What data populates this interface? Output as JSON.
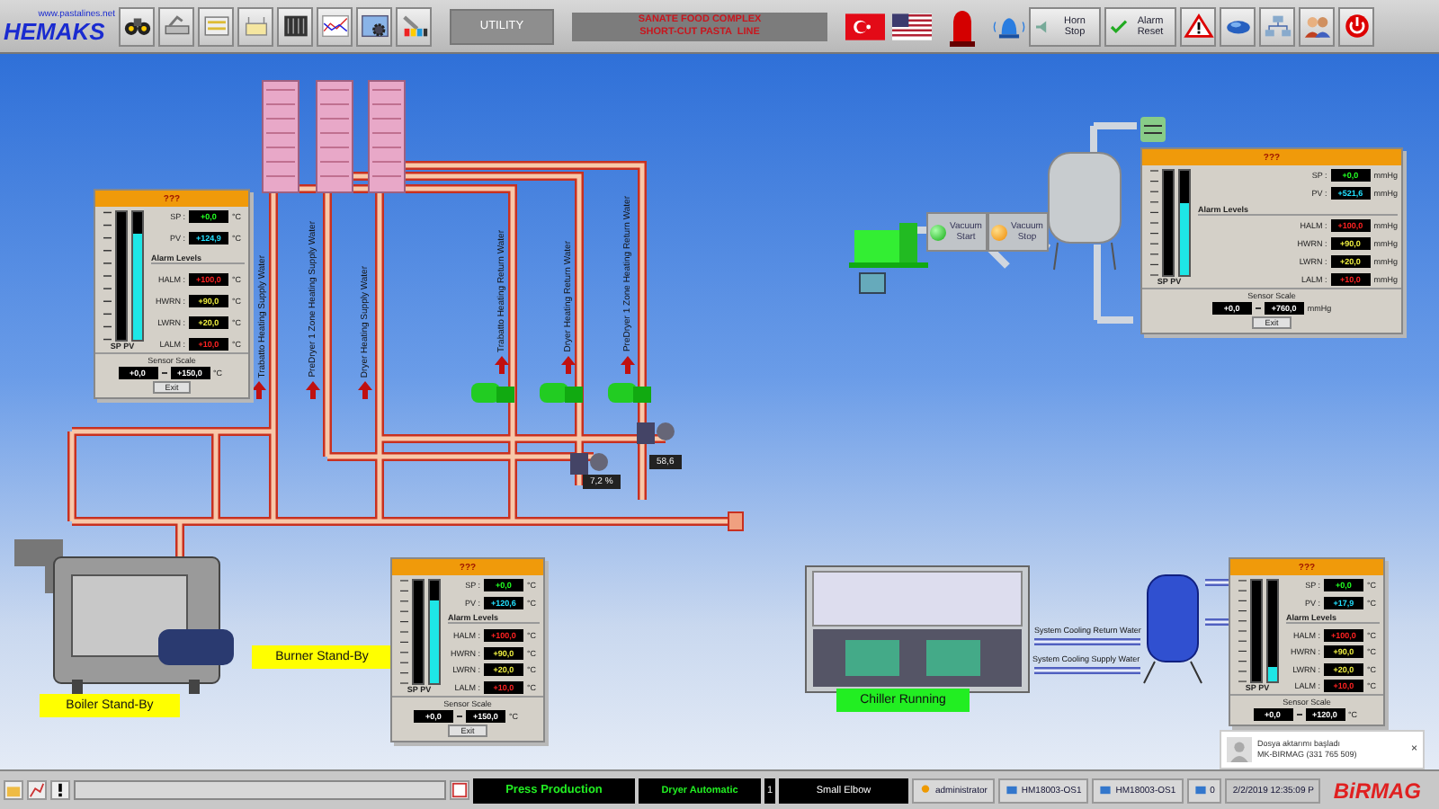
{
  "top_bar": {
    "website": "www.pastalines.net",
    "logo": "HEMAKS",
    "utility": "UTILITY",
    "plant_title": [
      "SANATE FOOD COMPLEX",
      "SHORT-CUT PASTA  LINE"
    ],
    "horn_stop": "Horn Stop",
    "alarm_reset": "Alarm Reset"
  },
  "pipe_labels": [
    "Trabatto Heating Supply Water",
    "PreDryer 1 Zone Heating Supply Water",
    "Dryer Heating Supply Water",
    "Trabatto Heating Return Water",
    "Dryer Heating Return Water",
    "PreDryer 1 Zone Heating Return Water"
  ],
  "readouts": [
    "7,2 %",
    "58,6"
  ],
  "vacuum_buttons": [
    {
      "label": "Vacuum Start",
      "kind": "start"
    },
    {
      "label": "Vacuum Stop",
      "kind": "stop"
    }
  ],
  "status_labels": [
    {
      "text": "Burner Stand-By",
      "kind": "standby"
    },
    {
      "text": "Boiler Stand-By",
      "kind": "standby"
    },
    {
      "text": "Chiller Running",
      "kind": "running"
    }
  ],
  "cooling_labels": [
    "System Cooling Return Water",
    "System Cooling Supply Water"
  ],
  "faceplates": [
    {
      "title": "???",
      "level": 0.83,
      "bar_label": "SP PV",
      "readings": [
        {
          "label": "SP :",
          "value": "+0,0",
          "unit": "°C",
          "kind": "sp"
        },
        {
          "label": "PV :",
          "value": "+124,9",
          "unit": "°C",
          "kind": "pv"
        }
      ],
      "alarm_title": "Alarm Levels",
      "alarms": [
        {
          "label": "HALM :",
          "value": "+100,0",
          "unit": "°C",
          "kind": "alarm"
        },
        {
          "label": "HWRN :",
          "value": "+90,0",
          "unit": "°C",
          "kind": "warning"
        },
        {
          "label": "LWRN :",
          "value": "+20,0",
          "unit": "°C",
          "kind": "warning"
        },
        {
          "label": "LALM :",
          "value": "+10,0",
          "unit": "°C",
          "kind": "alarm"
        }
      ],
      "scale": {
        "title": "Sensor Scale",
        "min": "+0,0",
        "max": "+150,0",
        "unit": "°C"
      },
      "exit": "Exit"
    },
    {
      "title": "???",
      "level": 0.69,
      "bar_label": "SP PV",
      "readings": [
        {
          "label": "SP :",
          "value": "+0,0",
          "unit": "mmHg",
          "kind": "sp"
        },
        {
          "label": "PV :",
          "value": "+521,6",
          "unit": "mmHg",
          "kind": "pv"
        }
      ],
      "alarm_title": "Alarm Levels",
      "alarms": [
        {
          "label": "HALM :",
          "value": "+100,0",
          "unit": "mmHg",
          "kind": "alarm"
        },
        {
          "label": "HWRN :",
          "value": "+90,0",
          "unit": "mmHg",
          "kind": "warning"
        },
        {
          "label": "LWRN :",
          "value": "+20,0",
          "unit": "mmHg",
          "kind": "warning"
        },
        {
          "label": "LALM :",
          "value": "+10,0",
          "unit": "mmHg",
          "kind": "alarm"
        }
      ],
      "scale": {
        "title": "Sensor Scale",
        "min": "+0,0",
        "max": "+760,0",
        "unit": "mmHg"
      },
      "exit": "Exit"
    },
    {
      "title": "???",
      "level": 0.8,
      "bar_label": "SP PV",
      "readings": [
        {
          "label": "SP :",
          "value": "+0,0",
          "unit": "°C",
          "kind": "sp"
        },
        {
          "label": "PV :",
          "value": "+120,6",
          "unit": "°C",
          "kind": "pv"
        }
      ],
      "alarm_title": "Alarm Levels",
      "alarms": [
        {
          "label": "HALM :",
          "value": "+100,0",
          "unit": "°C",
          "kind": "alarm"
        },
        {
          "label": "HWRN :",
          "value": "+90,0",
          "unit": "°C",
          "kind": "warning"
        },
        {
          "label": "LWRN :",
          "value": "+20,0",
          "unit": "°C",
          "kind": "warning"
        },
        {
          "label": "LALM :",
          "value": "+10,0",
          "unit": "°C",
          "kind": "alarm"
        }
      ],
      "scale": {
        "title": "Sensor Scale",
        "min": "+0,0",
        "max": "+150,0",
        "unit": "°C"
      },
      "exit": "Exit"
    },
    {
      "title": "???",
      "level": 0.15,
      "bar_label": "SP PV",
      "readings": [
        {
          "label": "SP :",
          "value": "+0,0",
          "unit": "°C",
          "kind": "sp"
        },
        {
          "label": "PV :",
          "value": "+17,9",
          "unit": "°C",
          "kind": "pv"
        }
      ],
      "alarm_title": "Alarm Levels",
      "alarms": [
        {
          "label": "HALM :",
          "value": "+100,0",
          "unit": "°C",
          "kind": "alarm"
        },
        {
          "label": "HWRN :",
          "value": "+90,0",
          "unit": "°C",
          "kind": "warning"
        },
        {
          "label": "LWRN :",
          "value": "+20,0",
          "unit": "°C",
          "kind": "warning"
        },
        {
          "label": "LALM :",
          "value": "+10,0",
          "unit": "°C",
          "kind": "alarm"
        }
      ],
      "scale": {
        "title": "Sensor Scale",
        "min": "+0,0",
        "max": "+120,0",
        "unit": "°C"
      }
    }
  ],
  "notification": {
    "title": "Dosya aktarımı başladı",
    "body": "MK-BIRMAG (331 765 509)",
    "close": "×"
  },
  "brand": "BiRMAG",
  "status_bar": {
    "mode": "Press Production",
    "dryer": "Dryer Automatic",
    "count": "1",
    "product": "Small Elbow",
    "user": "administrator",
    "station_a": "HM18003-OS1",
    "station_b": "HM18003-OS1",
    "alarms": "0",
    "datetime": "2/2/2019 12:35:09 P"
  }
}
